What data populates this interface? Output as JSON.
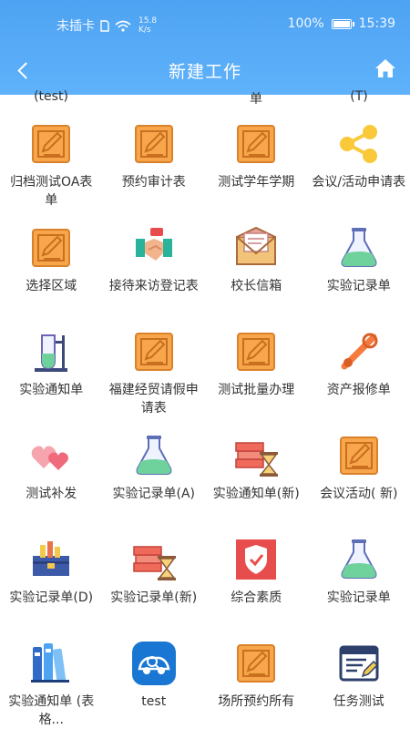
{
  "status_bar": {
    "carrier": "未插卡",
    "speed_value": "15.8",
    "speed_unit": "K/s",
    "battery": "100%",
    "time": "15:39"
  },
  "nav": {
    "title": "新建工作"
  },
  "partial_row": [
    "(test)",
    "单",
    "",
    "(T)"
  ],
  "colors": {
    "header": "#56aaf6",
    "form_icon": "#f7a64b",
    "flask_liquid": "#6fd19b"
  },
  "items": [
    {
      "label": "归档测试OA表单",
      "icon": "edit-form"
    },
    {
      "label": "预约审计表",
      "icon": "edit-form"
    },
    {
      "label": "测试学年学期",
      "icon": "edit-form"
    },
    {
      "label": "会议/活动申请表",
      "icon": "share"
    },
    {
      "label": "选择区域",
      "icon": "edit-form"
    },
    {
      "label": "接待来访登记表",
      "icon": "handshake"
    },
    {
      "label": "校长信箱",
      "icon": "envelope"
    },
    {
      "label": "实验记录单",
      "icon": "flask"
    },
    {
      "label": "实验通知单",
      "icon": "stand-tube"
    },
    {
      "label": "福建经贸请假申请表",
      "icon": "edit-form"
    },
    {
      "label": "测试批量办理",
      "icon": "edit-form"
    },
    {
      "label": "资产报修单",
      "icon": "tools"
    },
    {
      "label": "测试补发",
      "icon": "hearts"
    },
    {
      "label": "实验记录单(A)",
      "icon": "flask"
    },
    {
      "label": "实验通知单(新)",
      "icon": "books-hourglass"
    },
    {
      "label": "会议活动( 新)",
      "icon": "edit-form"
    },
    {
      "label": "实验记录单(D)",
      "icon": "toolbox"
    },
    {
      "label": "实验记录单(新)",
      "icon": "books-hourglass"
    },
    {
      "label": "综合素质",
      "icon": "shield"
    },
    {
      "label": "实验记录单",
      "icon": "flask"
    },
    {
      "label": "实验通知单 (表格...",
      "icon": "binders"
    },
    {
      "label": "test",
      "icon": "car-search"
    },
    {
      "label": "场所预约所有",
      "icon": "edit-form"
    },
    {
      "label": "任务测试",
      "icon": "task-edit"
    }
  ]
}
